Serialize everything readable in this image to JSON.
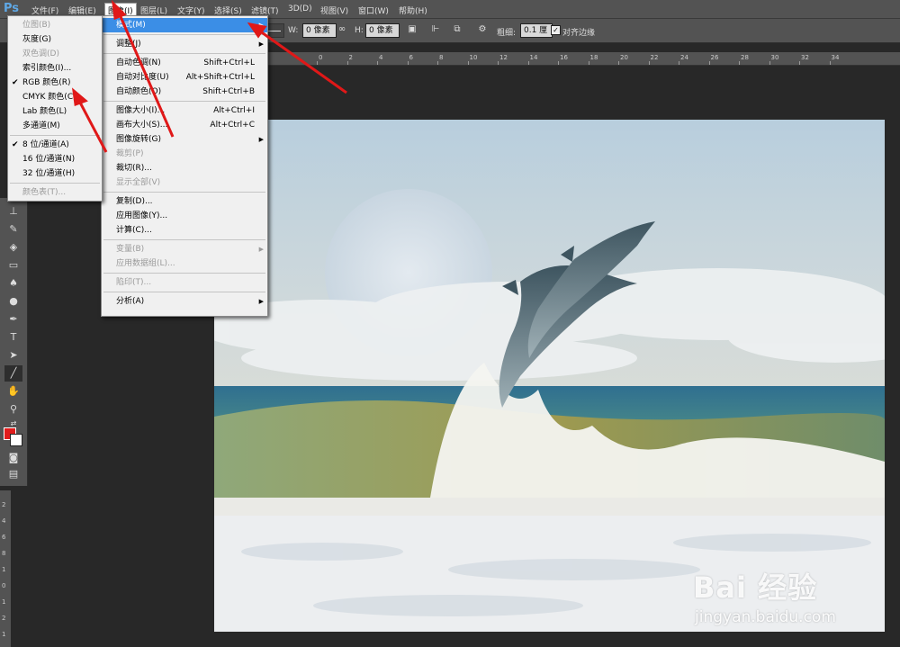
{
  "app": {
    "logo": "Ps"
  },
  "menubar": {
    "items": [
      "文件(F)",
      "编辑(E)",
      "图像(I)",
      "图层(L)",
      "文字(Y)",
      "选择(S)",
      "滤镜(T)",
      "3D(D)",
      "视图(V)",
      "窗口(W)",
      "帮助(H)"
    ],
    "active": "图像(I)"
  },
  "options": {
    "w_label": "W:",
    "w_value": "0 像素",
    "h_label": "H:",
    "h_value": "0 像素",
    "weight_label": "粗细:",
    "weight_value": "0.1 厘",
    "align_label": "对齐边缘",
    "align_checked": true
  },
  "ruler": {
    "top_labels": [
      "0",
      "2",
      "4",
      "6",
      "8",
      "10",
      "12",
      "14",
      "16",
      "18",
      "20",
      "22",
      "24",
      "26",
      "28",
      "30",
      "32",
      "34"
    ],
    "left_labels": [
      "2",
      "4",
      "6",
      "8",
      "1",
      "0",
      "1",
      "2",
      "1"
    ]
  },
  "image_menu": {
    "items": [
      {
        "label": "模式(M)",
        "submenu": true,
        "highlight": true
      },
      {
        "sep": true
      },
      {
        "label": "调整(J)",
        "submenu": true
      },
      {
        "sep": true
      },
      {
        "label": "自动色调(N)",
        "shortcut": "Shift+Ctrl+L"
      },
      {
        "label": "自动对比度(U)",
        "shortcut": "Alt+Shift+Ctrl+L"
      },
      {
        "label": "自动颜色(O)",
        "shortcut": "Shift+Ctrl+B"
      },
      {
        "sep": true
      },
      {
        "label": "图像大小(I)...",
        "shortcut": "Alt+Ctrl+I"
      },
      {
        "label": "画布大小(S)...",
        "shortcut": "Alt+Ctrl+C"
      },
      {
        "label": "图像旋转(G)",
        "submenu": true
      },
      {
        "label": "裁剪(P)",
        "disabled": true
      },
      {
        "label": "裁切(R)..."
      },
      {
        "label": "显示全部(V)",
        "disabled": true
      },
      {
        "sep": true
      },
      {
        "label": "复制(D)..."
      },
      {
        "label": "应用图像(Y)..."
      },
      {
        "label": "计算(C)..."
      },
      {
        "sep": true
      },
      {
        "label": "变量(B)",
        "submenu": true,
        "disabled": true
      },
      {
        "label": "应用数据组(L)...",
        "disabled": true
      },
      {
        "sep": true
      },
      {
        "label": "陷印(T)...",
        "disabled": true
      },
      {
        "sep": true
      },
      {
        "label": "分析(A)",
        "submenu": true
      }
    ]
  },
  "mode_menu": {
    "items": [
      {
        "label": "位图(B)",
        "disabled": true
      },
      {
        "label": "灰度(G)"
      },
      {
        "label": "双色调(D)",
        "disabled": true
      },
      {
        "label": "索引颜色(I)..."
      },
      {
        "label": "RGB 颜色(R)",
        "checked": true
      },
      {
        "label": "CMYK 颜色(C)"
      },
      {
        "label": "Lab 颜色(L)"
      },
      {
        "label": "多通道(M)"
      },
      {
        "sep": true
      },
      {
        "label": "8 位/通道(A)",
        "checked": true
      },
      {
        "label": "16 位/通道(N)"
      },
      {
        "label": "32 位/通道(H)"
      },
      {
        "sep": true
      },
      {
        "label": "颜色表(T)...",
        "disabled": true
      }
    ]
  },
  "toolbar": {
    "tools": [
      "stamp-icon",
      "history-brush-icon",
      "eraser-icon",
      "gradient-icon",
      "blur-icon",
      "dodge-icon",
      "pen-icon",
      "type-icon",
      "path-select-icon",
      "line-icon",
      "hand-icon",
      "zoom-icon"
    ],
    "fg_color": "#e01c1c",
    "bg_color": "#ffffff"
  },
  "watermark": {
    "brand": "Bai  经验",
    "url": "jingyan.baidu.com"
  },
  "colors": {
    "annotation_arrow": "#e01818",
    "menu_highlight": "#3b8ee6"
  }
}
